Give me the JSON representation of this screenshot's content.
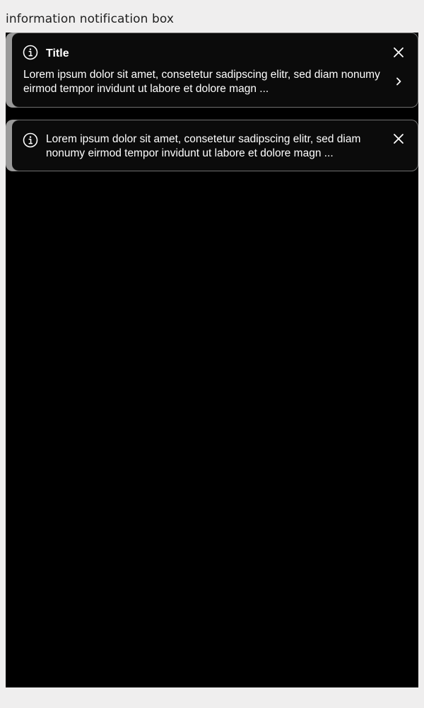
{
  "page": {
    "label": "information notification box"
  },
  "notifications": [
    {
      "title": "Title",
      "message": "Lorem ipsum dolor sit amet, consetetur sadipscing elitr, sed diam nonumy eirmod tempor invidunt ut labore et dolore magn ...",
      "icon": "info-icon",
      "actions": [
        "close-icon",
        "chevron-right-icon"
      ]
    },
    {
      "message": "Lorem ipsum dolor sit amet, consetetur sadipscing elitr, sed diam nonumy eirmod tempor invidunt ut labore et dolore magn ...",
      "icon": "info-icon",
      "actions": [
        "close-icon"
      ]
    }
  ],
  "colors": {
    "page_background": "#efeeee",
    "stage_background": "#000000",
    "notification_background": "#0b0b0b",
    "notification_border": "#6f6f6f",
    "accent_strip": "#9a9a9a",
    "text": "#ffffff"
  }
}
